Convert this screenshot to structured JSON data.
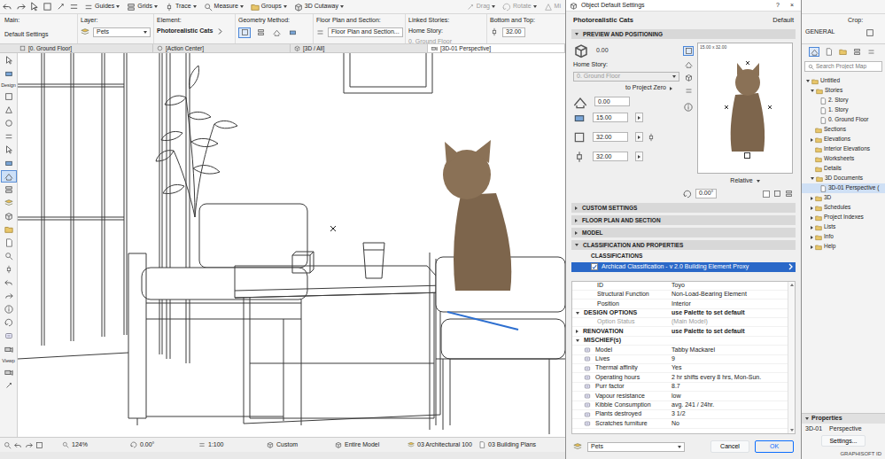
{
  "toolbar": {
    "buttons": [
      {
        "label": "Guides"
      },
      {
        "label": "Grids"
      },
      {
        "label": "Trace"
      },
      {
        "label": "Measure"
      },
      {
        "label": "Groups"
      },
      {
        "label": "3D Cutaway"
      }
    ],
    "edit_buttons": [
      {
        "label": "Drag",
        "disabled": true
      },
      {
        "label": "Rotate",
        "disabled": true
      },
      {
        "label": "Mi",
        "disabled": true
      }
    ]
  },
  "info_box": {
    "main": {
      "label": "Main:",
      "value": "Default Settings"
    },
    "layer": {
      "label": "Layer:",
      "value": "Pets"
    },
    "element": {
      "label": "Element:",
      "value": "Photorealistic Cats"
    },
    "geometry": {
      "label": "Geometry Method:",
      "options": [
        {
          "selected": true
        },
        {
          "selected": false
        },
        {
          "selected": false
        },
        {
          "selected": false
        }
      ]
    },
    "floor_plan": {
      "label": "Floor Plan and Section:",
      "value": "Floor Plan and Section..."
    },
    "linked_stories": {
      "label": "Linked Stories:",
      "value": "Home Story:",
      "story": "0. Ground Floor",
      "story_disabled": true
    },
    "bottom_top": {
      "label": "Bottom and Top:",
      "value": "32.00"
    },
    "crop": {
      "label": "Crop:"
    },
    "general": "GENERAL"
  },
  "tabs": [
    {
      "label": "[0. Ground Floor]",
      "selected": false
    },
    {
      "label": "[Action Center]",
      "selected": false
    },
    {
      "label": "[3D / All]",
      "selected": false
    },
    {
      "label": "[3D-01 Perspective]",
      "selected": true
    }
  ],
  "toolbox": {
    "design_label": "Design",
    "view_label": "Viewp",
    "top_tools": [
      {
        "selected": false
      },
      {
        "selected": false
      }
    ],
    "design_tools": [
      {
        "selected": false
      },
      {
        "selected": false
      },
      {
        "selected": false
      },
      {
        "selected": false
      },
      {
        "selected": false
      },
      {
        "selected": false
      },
      {
        "selected": true
      },
      {
        "selected": false
      },
      {
        "selected": false
      },
      {
        "selected": false
      },
      {
        "selected": false
      },
      {
        "selected": false
      },
      {
        "selected": false
      },
      {
        "selected": false
      },
      {
        "selected": false
      },
      {
        "selected": false
      },
      {
        "selected": false
      },
      {
        "selected": false
      },
      {
        "selected": false
      },
      {
        "selected": false
      }
    ],
    "view_tools": [
      {
        "selected": false
      },
      {
        "selected": false
      }
    ]
  },
  "status_bar": {
    "items": [
      "124%",
      "0.00°",
      "1:100",
      "Custom",
      "Entire Model",
      "03 Architectural 100",
      "03 Building Plans"
    ]
  },
  "dialog": {
    "title": "Object Default Settings",
    "help": "?",
    "close": "×",
    "object_name": "Photorealistic Cats",
    "default_label": "Default",
    "sections": [
      {
        "title": "PREVIEW AND POSITIONING",
        "expanded": true
      },
      {
        "title": "CUSTOM SETTINGS",
        "expanded": false
      },
      {
        "title": "FLOOR PLAN AND SECTION",
        "expanded": false
      },
      {
        "title": "MODEL",
        "expanded": false
      },
      {
        "title": "CLASSIFICATION AND PROPERTIES",
        "expanded": true
      }
    ],
    "preview": {
      "elevation": "0.00",
      "elevation_disabled": true,
      "home_story_label": "Home Story:",
      "home_story": "0. Ground Floor",
      "home_story_disabled": true,
      "reference": "to Project Zero",
      "offset": "0.00",
      "width": "15.00",
      "depth": "32.00",
      "height": "32.00",
      "dimension_caption": "15.00 x 32.00",
      "mode": "Relative",
      "angle": "0.00°",
      "view_modes": [
        {
          "selected": true
        },
        {
          "selected": false
        },
        {
          "selected": false
        },
        {
          "selected": false
        }
      ]
    },
    "classifications": {
      "title": "CLASSIFICATIONS",
      "items": [
        {
          "label": "Archicad Classification - v 2.0 Building Element Proxy",
          "checked": true,
          "selected": true
        }
      ]
    },
    "properties": [
      {
        "kind": "property",
        "label": "ID",
        "value": "Toyo",
        "disabled": false
      },
      {
        "kind": "property",
        "label": "Structural Function",
        "value": "Non-Load-Bearing Element",
        "disabled": false
      },
      {
        "kind": "property",
        "label": "Position",
        "value": "Interior",
        "disabled": false
      },
      {
        "kind": "group",
        "label": "DESIGN OPTIONS",
        "value": "use Palette to set default",
        "expanded": true,
        "disabled": false
      },
      {
        "kind": "property",
        "label": "Option Status",
        "value": "(Main Model)",
        "disabled": true
      },
      {
        "kind": "group",
        "label": "RENOVATION",
        "value": "use Palette to set default",
        "expanded": false,
        "disabled": false
      },
      {
        "kind": "group",
        "label": "MISCHIEF(s)",
        "expanded": true,
        "disabled": false
      },
      {
        "kind": "custom",
        "label": "Model",
        "value": "Tabby Mackarel",
        "disabled": false
      },
      {
        "kind": "custom",
        "label": "Lives",
        "value": "9",
        "disabled": false
      },
      {
        "kind": "custom",
        "label": "Thermal affinity",
        "value": "Yes",
        "disabled": false
      },
      {
        "kind": "custom",
        "label": "Operating hours",
        "value": "2 hr shifts every 8 hrs, Mon-Sun.",
        "disabled": false
      },
      {
        "kind": "custom",
        "label": "Purr factor",
        "value": "8.7",
        "disabled": false
      },
      {
        "kind": "custom",
        "label": "Vapour resistance",
        "value": "low",
        "disabled": false
      },
      {
        "kind": "custom",
        "label": "Kibble Consumption",
        "value": "avg. 241 / 24hr.",
        "disabled": false
      },
      {
        "kind": "custom",
        "label": "Plants destroyed",
        "value": "3 1/2",
        "disabled": false
      },
      {
        "kind": "custom",
        "label": "Scratches furniture",
        "value": "No",
        "disabled": false
      }
    ],
    "layer": "Pets",
    "buttons": [
      {
        "label": "Cancel",
        "primary": false
      },
      {
        "label": "OK",
        "primary": true
      }
    ]
  },
  "navigator": {
    "views": [
      {
        "selected": true
      },
      {
        "selected": false
      },
      {
        "selected": false
      },
      {
        "selected": false
      },
      {
        "selected": false
      }
    ],
    "search_placeholder": "Search Project Map",
    "tree": [
      {
        "label": "Untitled",
        "expanded": true,
        "selected": false,
        "children": [
          {
            "label": "Stories",
            "expanded": true,
            "selected": false,
            "children": [
              {
                "label": "2. Story",
                "selected": false
              },
              {
                "label": "1. Story",
                "selected": false
              },
              {
                "label": "0. Ground Floor",
                "selected": false
              }
            ]
          },
          {
            "label": "Sections",
            "selected": false
          },
          {
            "label": "Elevations",
            "expanded": false,
            "selected": false
          },
          {
            "label": "Interior Elevations",
            "selected": false
          },
          {
            "label": "Worksheets",
            "selected": false
          },
          {
            "label": "Details",
            "selected": false
          },
          {
            "label": "3D Documents",
            "expanded": true,
            "selected": false,
            "children": [
              {
                "label": "3D-01 Perspective (",
                "selected": true
              }
            ]
          },
          {
            "label": "3D",
            "expanded": false,
            "selected": false
          },
          {
            "label": "Schedules",
            "expanded": false,
            "selected": false
          },
          {
            "label": "Project Indexes",
            "expanded": false,
            "selected": false
          },
          {
            "label": "Lists",
            "expanded": false,
            "selected": false
          },
          {
            "label": "Info",
            "expanded": false,
            "selected": false
          },
          {
            "label": "Help",
            "expanded": false,
            "selected": false
          }
        ]
      }
    ],
    "properties": {
      "title": "Properties",
      "id": "3D-01",
      "name": "Perspective",
      "settings": "Settings..."
    },
    "brand": "GRAPHISOFT ID"
  }
}
